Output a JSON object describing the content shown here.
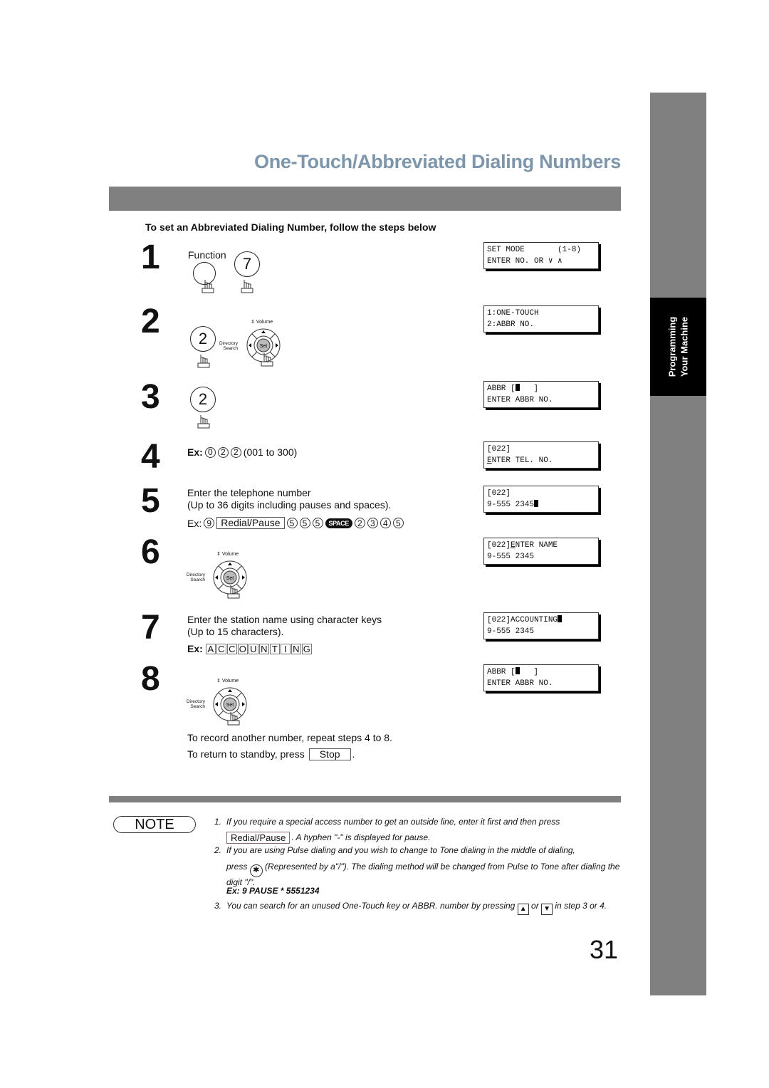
{
  "header": {
    "title": "One-Touch/Abbreviated Dialing Numbers",
    "subtitle": "To set an Abbreviated Dialing Number, follow the steps below"
  },
  "side_tab": {
    "line1": "Programming",
    "line2": "Your Machine"
  },
  "steps": [
    {
      "num": "1",
      "function_label": "Function",
      "key": "7"
    },
    {
      "num": "2",
      "key": "2",
      "nav": {
        "volume": "Volume",
        "dir1": "Directory",
        "dir2": "Search",
        "center": "Set"
      }
    },
    {
      "num": "3",
      "key": "2"
    },
    {
      "num": "4",
      "ex_label": "Ex:",
      "digits": [
        "0",
        "2",
        "2"
      ],
      "range": "(001 to 300)"
    },
    {
      "num": "5",
      "line1": "Enter the telephone number",
      "line2": "(Up to 36 digits including pauses and spaces).",
      "ex_label": "Ex:",
      "first_digit": "9",
      "redial_key": "Redial/Pause",
      "digits_a": [
        "5",
        "5",
        "5"
      ],
      "space_key": "SPACE",
      "digits_b": [
        "2",
        "3",
        "4",
        "5"
      ]
    },
    {
      "num": "6",
      "nav": {
        "volume": "Volume",
        "dir1": "Directory",
        "dir2": "Search",
        "center": "Set"
      }
    },
    {
      "num": "7",
      "line1": "Enter the station name using character keys",
      "line2": "(Up to 15 characters).",
      "ex_label": "Ex:",
      "chars": [
        "A",
        "C",
        "C",
        "O",
        "U",
        "N",
        "T",
        "I",
        "N",
        "G"
      ]
    },
    {
      "num": "8",
      "nav": {
        "volume": "Volume",
        "dir1": "Directory",
        "dir2": "Search",
        "center": "Set"
      }
    }
  ],
  "after_steps": {
    "repeat": "To record another number, repeat steps 4 to 8.",
    "standby": "To return to standby, press",
    "stop_key": "Stop",
    "period": "."
  },
  "lcd_displays": [
    {
      "l1": "SET MODE       (1-8)",
      "l2": "ENTER NO. OR ∨ ∧"
    },
    {
      "l1": "1:ONE-TOUCH",
      "l2": "2:ABBR NO."
    },
    {
      "l1a": "ABBR [",
      "l1b": "   ]",
      "l2": "ENTER ABBR NO."
    },
    {
      "l1": "[022]",
      "l2a": "E",
      "l2b": "NTER TEL. NO."
    },
    {
      "l1": "[022]",
      "l2": "9-555 2345"
    },
    {
      "l1a": "[022]",
      "l1u": "E",
      "l1b": "NTER NAME",
      "l2": "9-555 2345"
    },
    {
      "l1": "[022]ACCOUNTING",
      "l2": "9-555 2345"
    },
    {
      "l1a": "ABBR [",
      "l1b": "   ]",
      "l2": "ENTER ABBR NO."
    }
  ],
  "note": {
    "label": "NOTE",
    "items": [
      {
        "num": "1.",
        "text1": "If you require a special access number to get an outside line, enter it first and then press",
        "key": "Redial/Pause",
        "text2": ". A hyphen \"-\" is displayed for pause."
      },
      {
        "num": "2.",
        "text1": "If you are using Pulse dialing and you wish to change to Tone dialing in the middle of dialing,",
        "press": "press",
        "star": "✱",
        "text2": "(Represented by a\"/\"). The dialing method will be changed from Pulse to Tone after dialing the digit \"/\".",
        "example": "Ex: 9 PAUSE * 5551234"
      },
      {
        "num": "3.",
        "text1": "You can search for an unused One-Touch key or ABBR. number by pressing",
        "up": "▲",
        "or": "or",
        "down": "▼",
        "text2": "in step 3 or 4."
      }
    ]
  },
  "page_number": "31"
}
